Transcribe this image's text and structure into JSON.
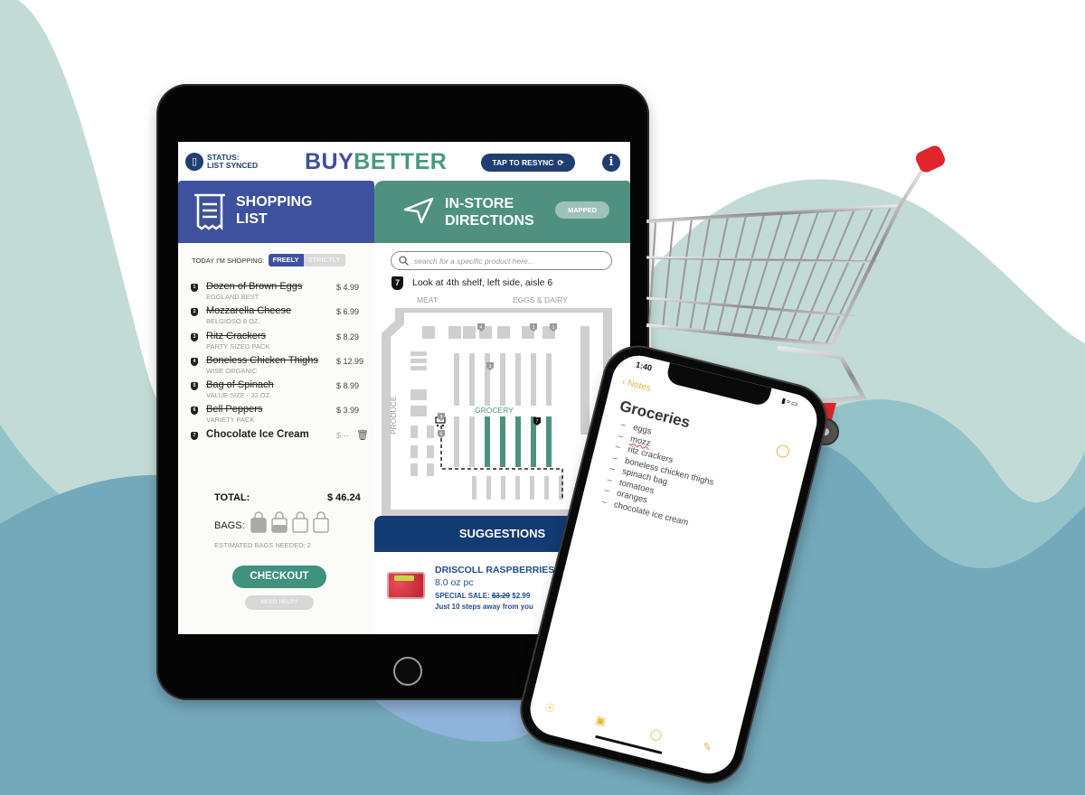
{
  "colors": {
    "background_light": "#c3dbd6",
    "background_mid": "#94c2c9",
    "background_deep": "#74a9bb",
    "background_blue": "#8fb3da",
    "shopping_tab": "#3e519f",
    "directions_tab": "#4f9180",
    "navy": "#1f3f73",
    "checkout": "#3f927d",
    "notes_accent": "#e4b63b"
  },
  "tablet": {
    "header": {
      "status_label": "STATUS:",
      "status_value": "LIST SYNCED",
      "brand_part1": "BUY",
      "brand_part2": "BETTER",
      "resync_label": "TAP TO RESYNC",
      "info_icon": "i"
    },
    "tabs": {
      "shopping": {
        "line1": "SHOPPING",
        "line2": "LIST",
        "icon": "receipt-icon"
      },
      "directions": {
        "line1": "IN-STORE",
        "line2": "DIRECTIONS",
        "icon": "navigation-arrow-icon",
        "badge": "MAPPED"
      }
    },
    "shopping_list": {
      "mode_label": "TODAY I'M SHOPPING:",
      "mode_options": [
        "FREELY",
        "STRICTLY"
      ],
      "mode_selected": "FREELY",
      "items": [
        {
          "num": "1",
          "name": "Dozen of Brown Eggs",
          "sub": "EGGLAND BEST",
          "price": "$ 4.99",
          "checked": true
        },
        {
          "num": "2",
          "name": "Mozzarella Cheese",
          "sub": "BELGIOSO 8 OZ.",
          "price": "$ 6.99",
          "checked": true
        },
        {
          "num": "3",
          "name": "Ritz Crackers",
          "sub": "PARTY SIZED PACK",
          "price": "$ 8.29",
          "checked": true
        },
        {
          "num": "4",
          "name": "Boneless Chicken Thighs",
          "sub": "WISE ORGANIC",
          "price": "$ 12.99",
          "checked": true
        },
        {
          "num": "5",
          "name": "Bag of Spinach",
          "sub": "VALUE SIZE - 32 OZ.",
          "price": "$ 8.99",
          "checked": true
        },
        {
          "num": "6",
          "name": "Bell Peppers",
          "sub": "VARIETY PACK",
          "price": "$ 3.99",
          "checked": true
        },
        {
          "num": "7",
          "name": "Chocolate Ice Cream",
          "sub": "",
          "price": "$ --",
          "checked": false
        }
      ],
      "total_label": "TOTAL:",
      "total_value": "$ 46.24",
      "bags_label": "BAGS:",
      "bags_fill": [
        1.0,
        0.5,
        0.0,
        0.0
      ],
      "bags_estimate": "ESTIMATED BAGS NEEDED: 2",
      "checkout_label": "CHECKOUT",
      "help_label": "NEED HELP?"
    },
    "directions": {
      "search_placeholder": "search for a specific product here...",
      "step_number": "7",
      "step_text": "Look at 4th shelf, left side, aisle 6",
      "zones": {
        "meat": "MEAT",
        "eggs_dairy": "EGGS & DAIRY",
        "produce": "PRODUCE",
        "grocery": "GROCERY"
      },
      "map_markers": [
        "1",
        "2",
        "3",
        "4",
        "5",
        "6",
        "7"
      ]
    },
    "suggestions": {
      "header": "SUGGESTIONS",
      "product": "DRISCOLL RASPBERRIES",
      "size": "8.0 oz pc",
      "sale_label": "SPECIAL SALE:",
      "old_price": "$3.29",
      "new_price": "$2.99",
      "distance": "Just 10 steps away from you"
    }
  },
  "phone": {
    "time": "1:40",
    "back_label": "Notes",
    "note_title": "Groceries",
    "note_items": [
      "eggs",
      "mozz",
      "ritz crackers",
      "boneless chicken thighs",
      "spinach bag",
      "tomatoes",
      "oranges",
      "chocolate ice cream"
    ],
    "misspelled_item": "mozz",
    "toolbar_icons": [
      "checklist-icon",
      "camera-icon",
      "markup-pen-icon",
      "compose-icon"
    ]
  }
}
